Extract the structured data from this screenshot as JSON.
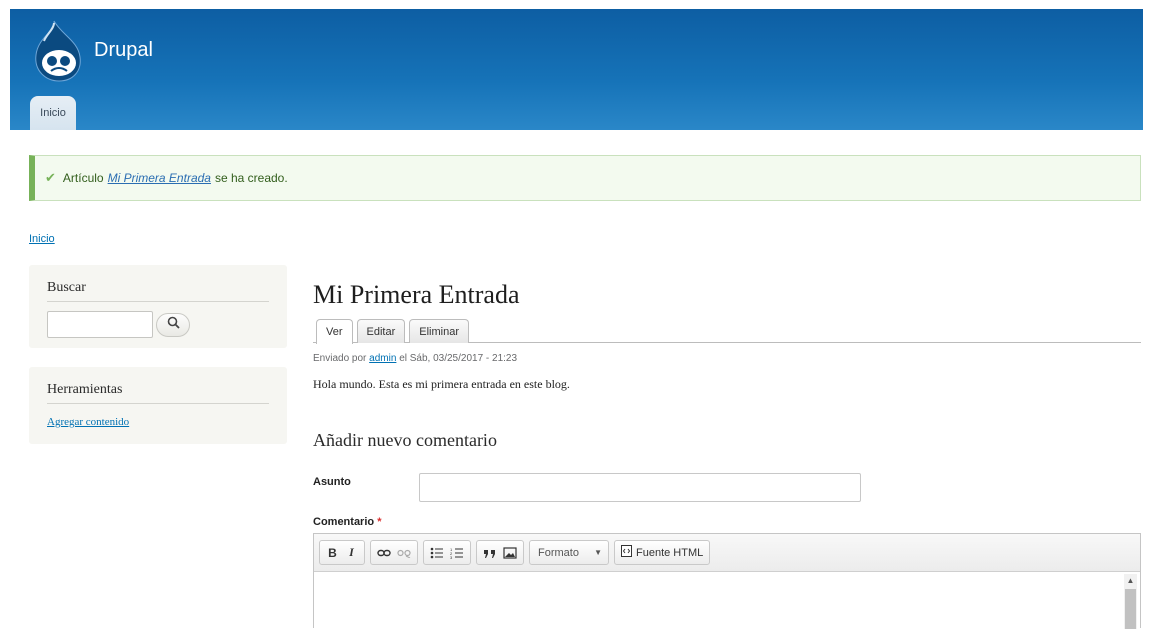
{
  "header": {
    "site_name": "Drupal",
    "nav_tab": "Inicio",
    "brand_color": "#0d5ea3"
  },
  "message": {
    "prefix": "Artículo",
    "link_text": "Mi Primera Entrada",
    "suffix": "se ha creado.",
    "icon": "check-icon"
  },
  "breadcrumb": "Inicio",
  "sidebar": {
    "search": {
      "title": "Buscar",
      "input_value": "",
      "button_icon": "search-icon"
    },
    "tools": {
      "title": "Herramientas",
      "link": "Agregar contenido"
    }
  },
  "node": {
    "title": "Mi Primera Entrada",
    "tabs": [
      "Ver",
      "Editar",
      "Eliminar"
    ],
    "submitted_prefix": "Enviado por",
    "author": "admin",
    "submitted_suffix": "el Sáb, 03/25/2017 - 21:23",
    "body": "Hola mundo. Esta es mi primera entrada en este blog."
  },
  "comment": {
    "section_title": "Añadir nuevo comentario",
    "subject_label": "Asunto",
    "subject_value": "",
    "comment_label": "Comentario",
    "required_mark": "*",
    "toolbar": {
      "bold": "B",
      "italic": "I",
      "format_label": "Formato",
      "source_label": "Fuente HTML"
    }
  }
}
